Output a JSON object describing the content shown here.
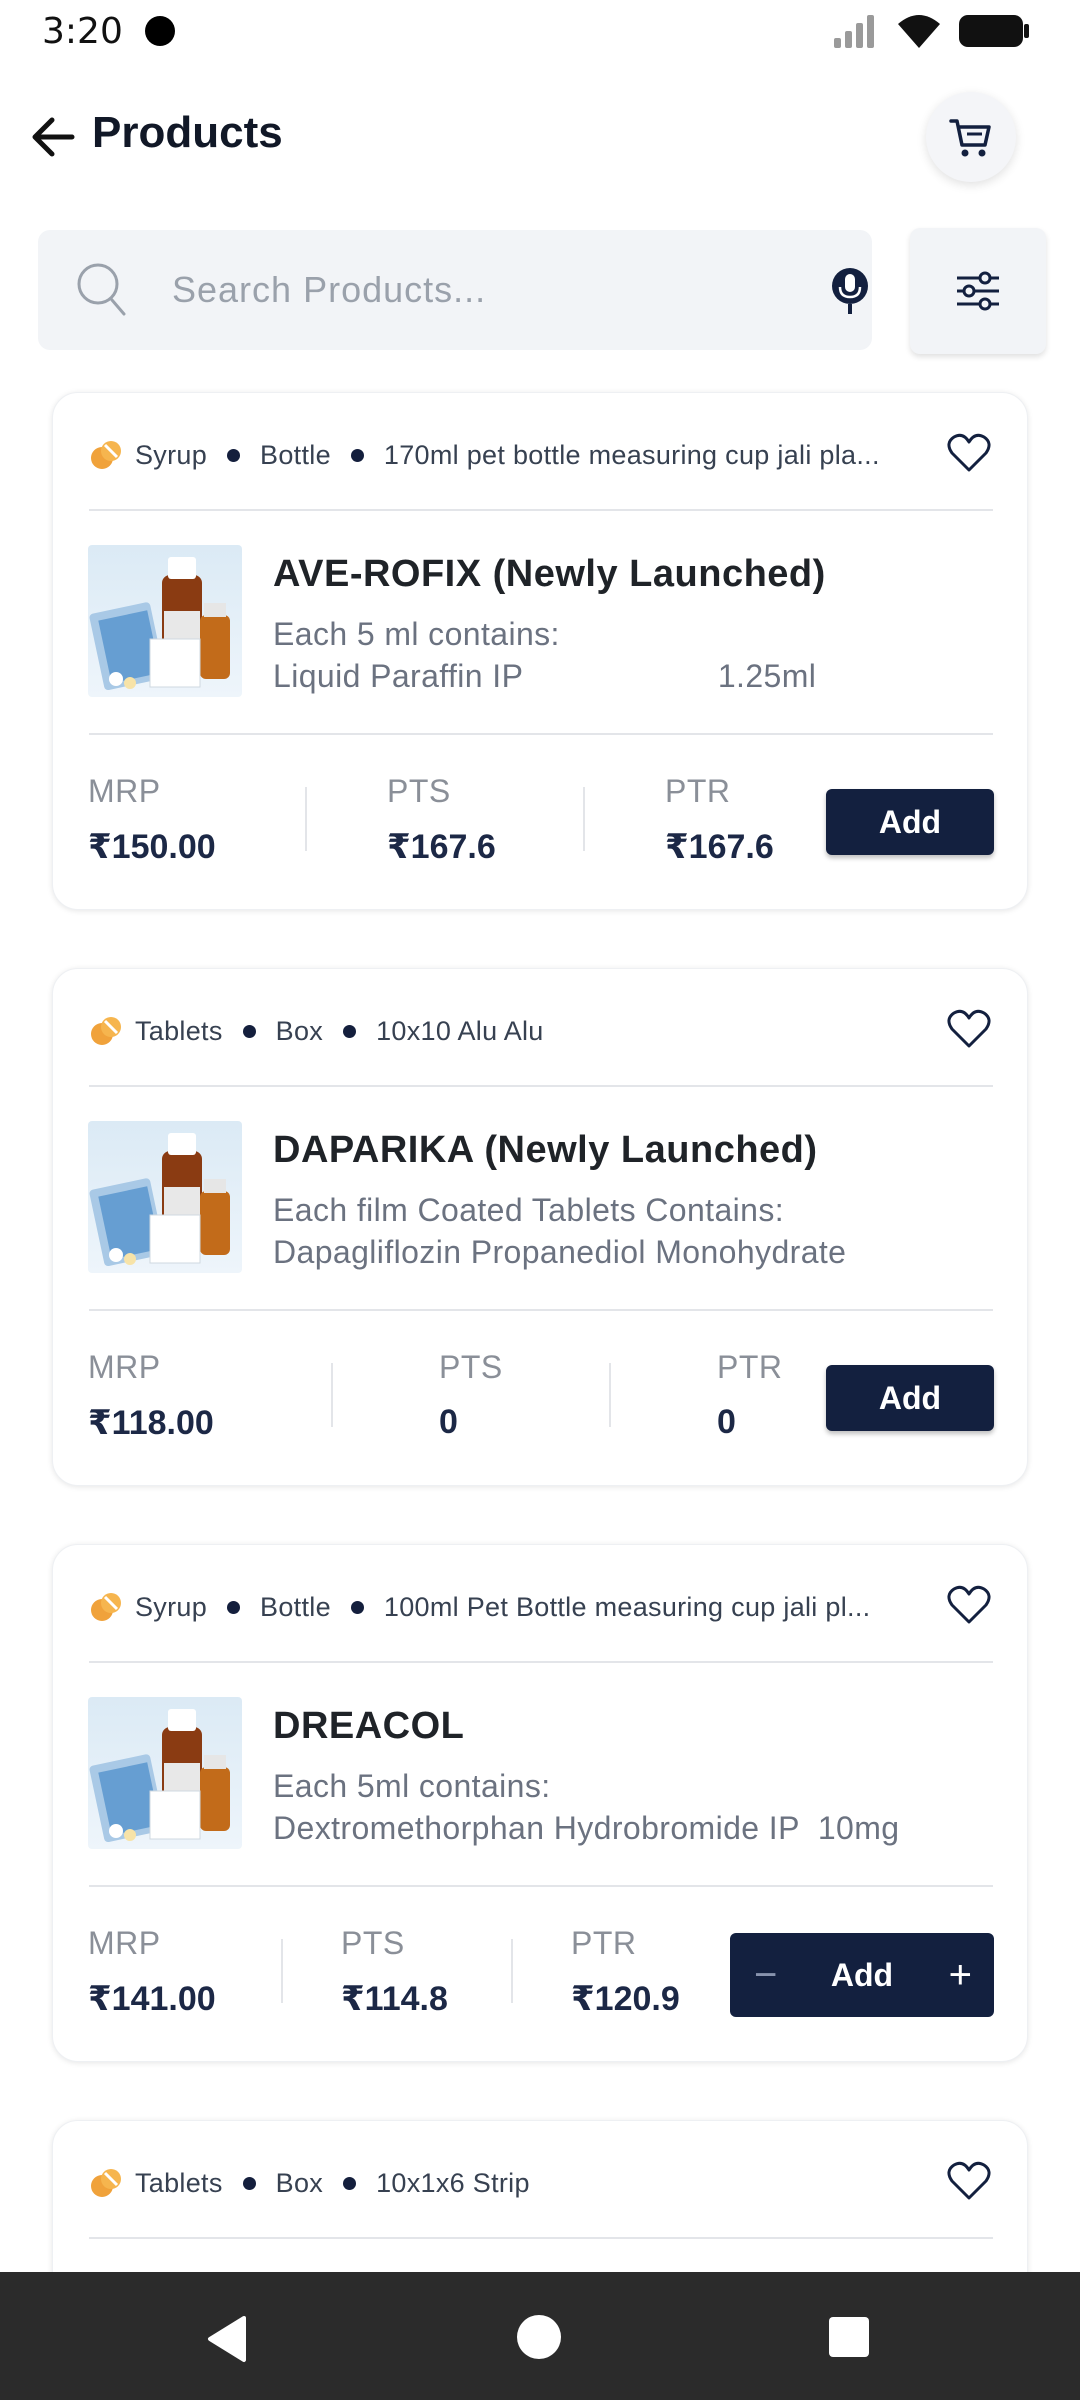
{
  "status_bar": {
    "time": "3:20"
  },
  "header": {
    "title": "Products"
  },
  "search": {
    "placeholder": "Search Products..."
  },
  "colors": {
    "primary": "#13203f",
    "accent_orange": "#f0a23b",
    "background": "#ffffff",
    "nav_bar": "#2b2b2b"
  },
  "price_labels": {
    "mrp": "MRP",
    "pts": "PTS",
    "ptr": "PTR"
  },
  "products": [
    {
      "form": "Syrup",
      "container": "Bottle",
      "pack": "170ml pet bottle measuring cup jali pla...",
      "name": "AVE-ROFIX (Newly Launched)",
      "desc1": "Each 5 ml contains:",
      "desc2": "Liquid Paraffin IP                     1.25ml",
      "mrp": "₹150.00",
      "pts": "₹167.6",
      "ptr": "₹167.6",
      "button": "Add"
    },
    {
      "form": "Tablets",
      "container": "Box",
      "pack": "10x10 Alu Alu",
      "name": "DAPARIKA (Newly Launched)",
      "desc1": "Each film Coated Tablets Contains:",
      "desc2": "Dapagliflozin Propanediol Monohydrate",
      "mrp": "₹118.00",
      "pts": "0",
      "ptr": "0",
      "button": "Add"
    },
    {
      "form": "Syrup",
      "container": "Bottle",
      "pack": "100ml Pet  Bottle  measuring cup jali pl...",
      "name": "DREACOL",
      "desc1": "Each 5ml contains:",
      "desc2": "Dextromethorphan Hydrobromide IP  10mg",
      "mrp": "₹141.00",
      "pts": "₹114.8",
      "ptr": "₹120.9",
      "button": "Add",
      "stepper_minus": "−",
      "stepper_plus": "+"
    },
    {
      "form": "Tablets",
      "container": "Box",
      "pack": "10x1x6 Strip"
    }
  ],
  "icons": {
    "back": "arrow-left-icon",
    "cart": "cart-icon",
    "search": "search-icon",
    "mic": "mic-icon",
    "filter": "filter-sliders-icon",
    "favorite": "heart-icon",
    "category": "pill-icon"
  }
}
